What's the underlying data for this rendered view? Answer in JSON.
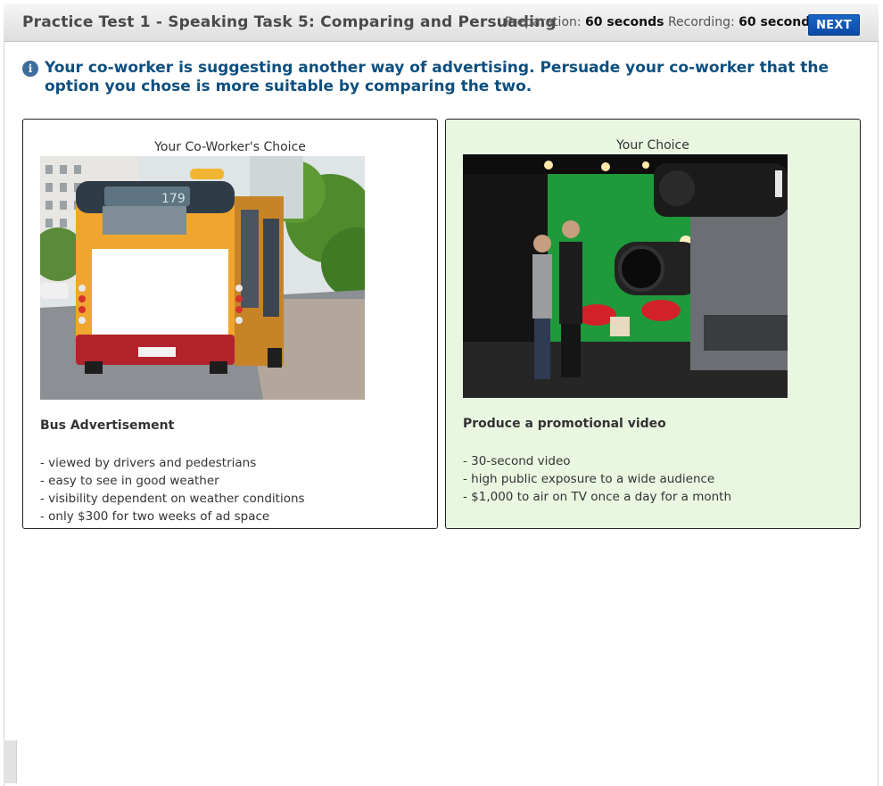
{
  "header": {
    "title": "Practice Test 1 - Speaking Task 5: Comparing and Persuading",
    "preparation_label": "Preparation:",
    "preparation_value": "60 seconds",
    "recording_label": "Recording:",
    "recording_value": "60 seconds",
    "next_label": "NEXT"
  },
  "instruction": {
    "icon": "info-icon",
    "text": "Your co-worker is suggesting another way of advertising. Persuade your co-worker that the option you chose is more suitable by comparing the two."
  },
  "options": [
    {
      "heading": "Your Co-Worker's Choice",
      "title": "Bus Advertisement",
      "points": [
        "- viewed by drivers and pedestrians",
        "- easy to see in good weather",
        "- visibility dependent on weather conditions",
        "- only $300 for two weeks of ad space"
      ],
      "photo_text": "179"
    },
    {
      "heading": "Your Choice",
      "title": "Produce a promotional video",
      "points": [
        "- 30-second video",
        "- high public exposure to a wide audience",
        "- $1,000 to air on TV once a day for a month"
      ]
    }
  ],
  "colors": {
    "accent": "#0b4aa4",
    "instruction": "#0d4f7f",
    "selected_panel_bg": "#e9f7e1"
  }
}
